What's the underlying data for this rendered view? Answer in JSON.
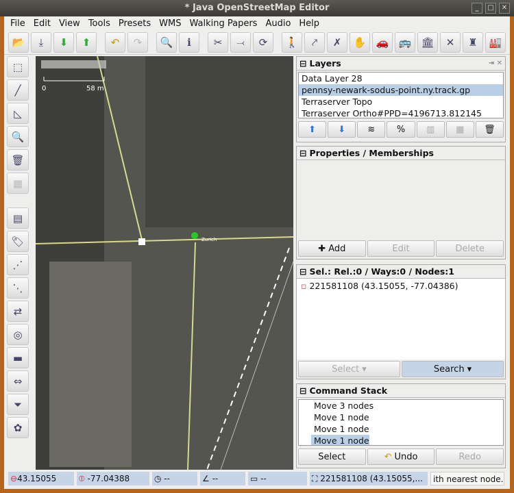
{
  "title": "* Java OpenStreetMap Editor",
  "menu": [
    "File",
    "Edit",
    "View",
    "Tools",
    "Presets",
    "WMS",
    "Walking Papers",
    "Audio",
    "Help"
  ],
  "map": {
    "scale_left": "0",
    "scale_right": "58 m",
    "node_label": "Zurich"
  },
  "layers": {
    "title": "Layers",
    "items": [
      "Data Layer 28",
      "pennsy-newark-sodus-point.ny.track.gp",
      "Terraserver Topo",
      "Terraserver Ortho#PPD=4196713.812145"
    ]
  },
  "properties": {
    "title": "Properties / Memberships",
    "add": "Add",
    "edit": "Edit",
    "delete": "Delete"
  },
  "selection": {
    "title": "Sel.: Rel.:0 / Ways:0 / Nodes:1",
    "items": [
      "221581108 (43.15055, -77.04386)"
    ],
    "select": "Select",
    "search": "Search"
  },
  "commands": {
    "title": "Command Stack",
    "items": [
      "Move 3 nodes",
      "Move 1 node",
      "Move 1 node",
      "Move 1 node"
    ],
    "select": "Select",
    "undo": "Undo",
    "redo": "Redo"
  },
  "status": {
    "lat": "43.15055",
    "lon": "-77.04388",
    "heading": "--",
    "angle": "--",
    "distance": "--",
    "node": "221581108 (43.15055,...",
    "help": "ith nearest node."
  }
}
